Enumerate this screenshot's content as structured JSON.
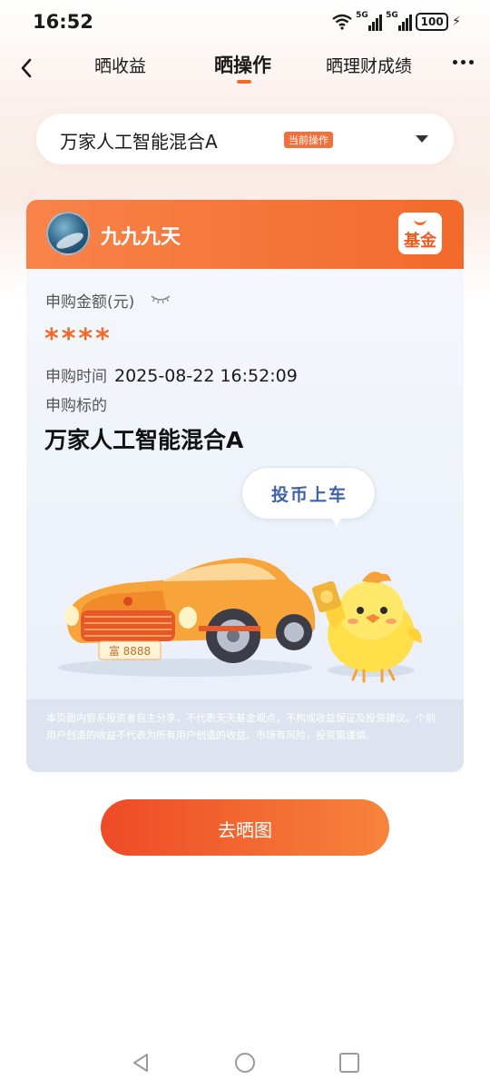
{
  "status_bar": {
    "time": "16:52",
    "signal1_label": "5G",
    "signal2_label": "5G",
    "battery": "100"
  },
  "nav": {
    "back_icon": "chevron-left-icon",
    "tabs": [
      {
        "label": "晒收益",
        "active": false
      },
      {
        "label": "晒操作",
        "active": true
      },
      {
        "label": "晒理财成绩",
        "active": false
      }
    ],
    "more_icon": "more-dots-icon"
  },
  "fund_selector": {
    "name": "万家人工智能混合A",
    "badge": "当前操作",
    "dropdown_icon": "caret-down-icon"
  },
  "card": {
    "username": "九九九天",
    "logo_text": "基金",
    "amount_label": "申购金额(元)",
    "amount_masked": "****",
    "time_label": "申购时间",
    "time_value": "2025-08-22 16:52:09",
    "target_label": "申购标的",
    "target_value": "万家人工智能混合A",
    "bubble_text": "投币上车",
    "plate_text": "富 8888",
    "disclaimer": "本页面内容系投资者自主分享，不代表天天基金观点，不构成收益保证及投资建议。个别用户创造的收益不代表为所有用户创造的收益。市场有风险，投资需谨慎。"
  },
  "cta": {
    "label": "去晒图"
  },
  "colors": {
    "accent": "#f26b2a",
    "cta_start": "#ee4a26",
    "cta_end": "#f6843c",
    "bubble_text": "#3e62a8"
  }
}
